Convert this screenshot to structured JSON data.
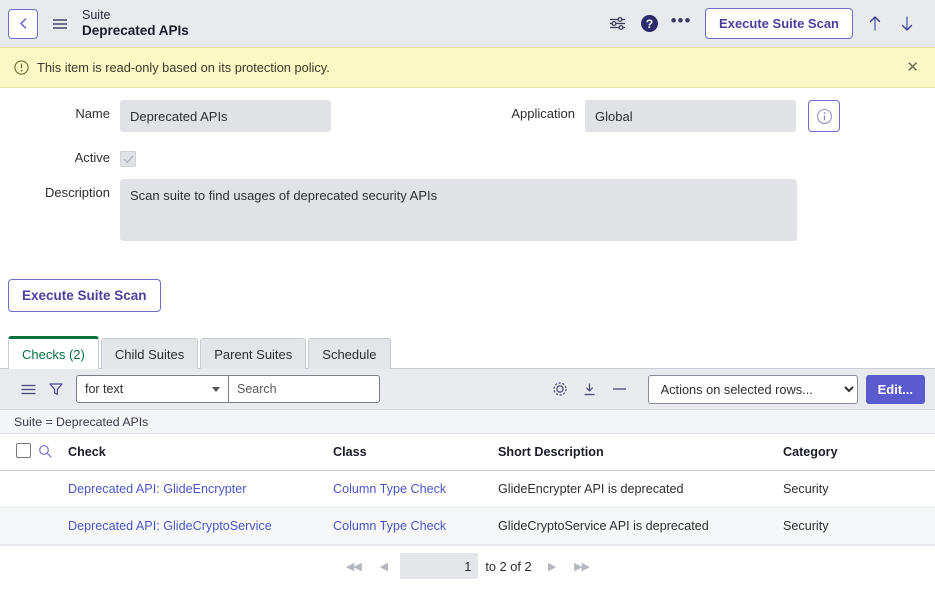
{
  "header": {
    "back_icon": "chevron-left-icon",
    "menu_icon": "hamburger-icon",
    "record_type": "Suite",
    "record_title": "Deprecated APIs",
    "personalize_icon": "sliders-icon",
    "help_icon": "help-circle-icon",
    "more_icon": "ellipsis-icon",
    "execute_label": "Execute Suite Scan",
    "prev_record_icon": "arrow-up-icon",
    "next_record_icon": "arrow-down-icon"
  },
  "banner": {
    "icon": "exclamation-circle-icon",
    "message": "This item is read-only based on its protection policy.",
    "close_label": "✕"
  },
  "form": {
    "name_label": "Name",
    "name_value": "Deprecated APIs",
    "active_label": "Active",
    "active_checked": true,
    "description_label": "Description",
    "description_value": "Scan suite to find usages of deprecated security APIs",
    "application_label": "Application",
    "application_value": "Global",
    "info_icon": "info-circle-icon"
  },
  "body_actions": {
    "execute_label": "Execute Suite Scan"
  },
  "tabs": [
    {
      "label": "Checks (2)",
      "active": true
    },
    {
      "label": "Child Suites",
      "active": false
    },
    {
      "label": "Parent Suites",
      "active": false
    },
    {
      "label": "Schedule",
      "active": false
    }
  ],
  "list_toolbar": {
    "menu_icon": "list-menu-icon",
    "filter_icon": "funnel-icon",
    "search_field_value": "for text",
    "search_field_options": [
      "for text"
    ],
    "search_placeholder": "Search",
    "settings_icon": "gear-icon",
    "export_icon": "download-icon",
    "collapse_icon": "minus-icon",
    "actions_selected_value": "Actions on selected rows...",
    "actions_options": [
      "Actions on selected rows..."
    ],
    "edit_label": "Edit..."
  },
  "breadcrumb": {
    "text": "Suite = Deprecated APIs"
  },
  "table": {
    "select_all_icon": "checkbox-icon",
    "search_row_icon": "magnifier-icon",
    "columns": [
      "Check",
      "Class",
      "Short Description",
      "Category"
    ],
    "rows": [
      {
        "check": "Deprecated API: GlideEncrypter",
        "class": "Column Type Check",
        "short_description": "GlideEncrypter API is deprecated",
        "category": "Security"
      },
      {
        "check": "Deprecated API: GlideCryptoService",
        "class": "Column Type Check",
        "short_description": "GlideCryptoService API is deprecated",
        "category": "Security"
      }
    ]
  },
  "pagination": {
    "first_icon": "◀◀",
    "prev_icon": "◀",
    "page_number": "1",
    "range_text": "to 2 of 2",
    "next_icon": "▶",
    "last_icon": "▶▶"
  },
  "colors": {
    "accent_purple": "#5b5bd0",
    "link_blue": "#4b55c8",
    "tab_green": "#06713f",
    "banner_yellow": "#fbf8c6",
    "header_grey": "#e8eaed",
    "readonly_field": "#e0e2e6"
  }
}
